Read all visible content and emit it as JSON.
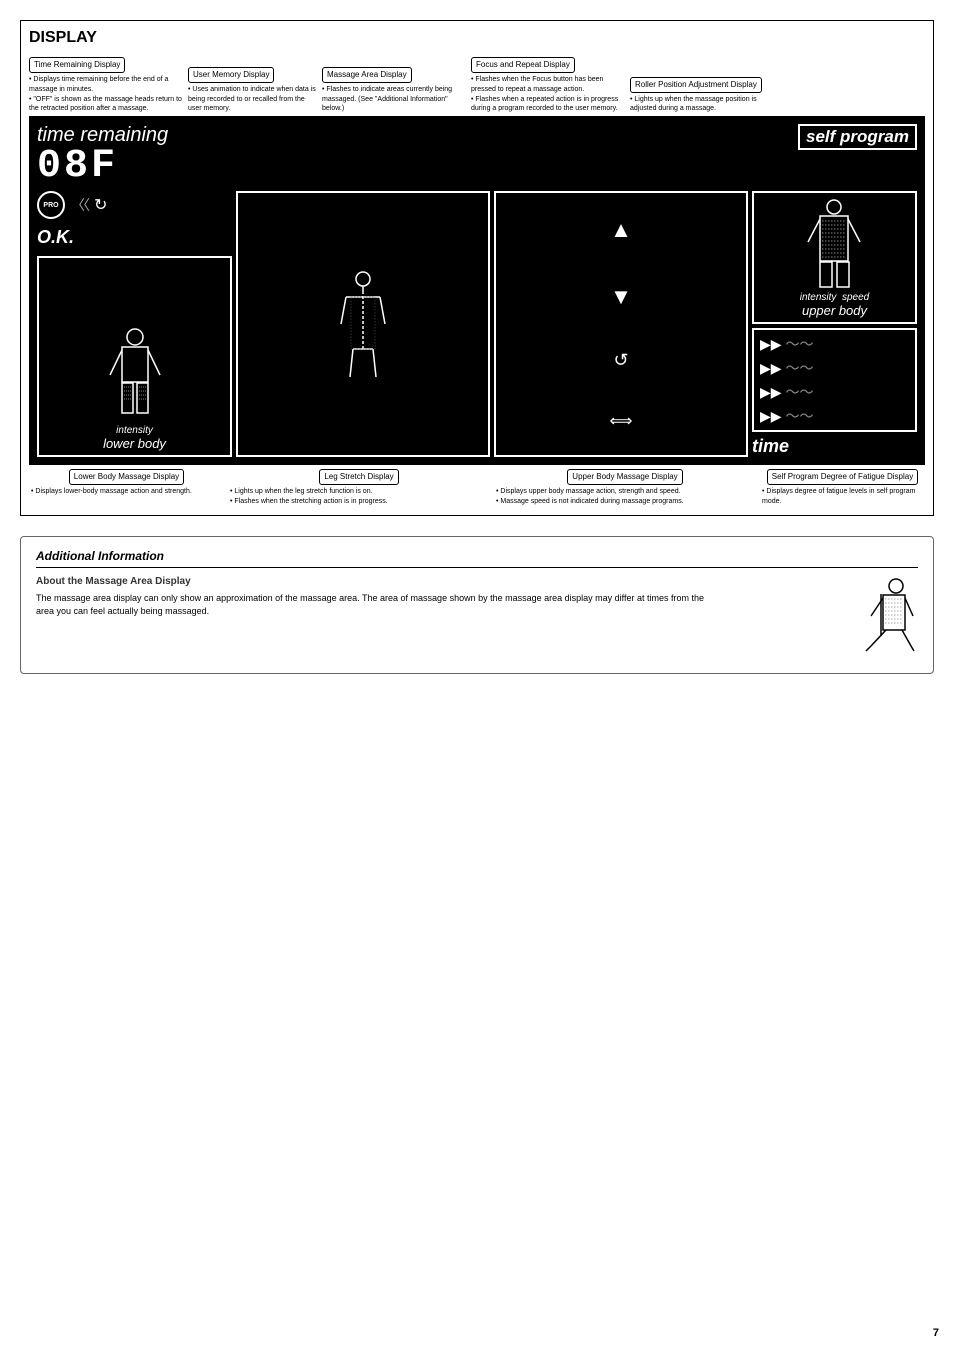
{
  "page": {
    "number": "7"
  },
  "display_section": {
    "title": "DISPLAY",
    "top_labels": [
      {
        "id": "time-remaining-display",
        "title": "Time Remaining Display",
        "desc": [
          "Displays time remaining before the end of a massage in minutes.",
          "\"OFF\" is shown as the massage heads return to the retracted position after a massage."
        ]
      },
      {
        "id": "user-memory-display",
        "title": "User Memory Display",
        "desc": [
          "Uses animation to indicate when data is being recorded to or recalled from the user memory."
        ]
      },
      {
        "id": "massage-area-display",
        "title": "Massage Area Display",
        "desc": [
          "Flashes to indicate areas currently being massaged. (See \"Additional Information\" below.)"
        ]
      },
      {
        "id": "focus-repeat-display",
        "title": "Focus and Repeat Display",
        "desc": [
          "Flashes when the Focus button has been pressed to repeat a massage action.",
          "Flashes when a repeated action is in progress during a program recorded to the user memory."
        ]
      },
      {
        "id": "roller-position-display",
        "title": "Roller Position Adjustment Display",
        "desc": [
          "Lights up when the massage position is adjusted during a massage."
        ]
      }
    ],
    "panel": {
      "time_remaining_text": "time remaining",
      "digit_display": "08F",
      "self_program_text": "self program",
      "ok_text": "O.K.",
      "pro_text": "PRO",
      "intensity_lower": "intensity",
      "lower_body_text": "lower body",
      "intensity_upper": "intensity",
      "speed_text": "speed",
      "upper_body_text": "upper body",
      "time_text": "time"
    },
    "bottom_labels": [
      {
        "id": "lower-body-massage-display",
        "title": "Lower Body Massage Display",
        "desc": [
          "Displays lower-body massage action and strength."
        ]
      },
      {
        "id": "leg-stretch-display",
        "title": "Leg Stretch Display",
        "desc": [
          "Lights up when the leg stretch function is on.",
          "Flashes when the stretching action is in progress."
        ]
      },
      {
        "id": "upper-body-massage-display",
        "title": "Upper Body Massage Display",
        "desc": [
          "Displays upper body massage action, strength and speed.",
          "Massage speed is not indicated during massage programs."
        ]
      },
      {
        "id": "fatigue-display",
        "title": "Self Program Degree of Fatigue Display",
        "desc": [
          "Displays degree of fatigue levels in self program mode."
        ]
      }
    ]
  },
  "additional_info": {
    "section_title": "Additional Information",
    "subtitle": "About the Massage Area Display",
    "body": "The massage area display can only show an approximation of the massage area. The area of massage shown by the massage area display may differ at times from the area you can feel actually being massaged."
  }
}
